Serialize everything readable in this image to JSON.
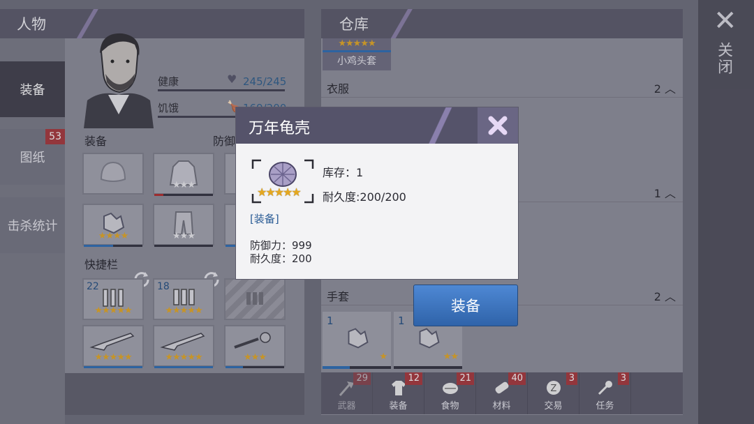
{
  "character": {
    "header": "人物",
    "tabs": [
      {
        "label": "装备",
        "active": true
      },
      {
        "label": "图纸",
        "badge": "53"
      },
      {
        "label": "击杀统计"
      }
    ],
    "stats": [
      {
        "label": "健康",
        "value": "245/245",
        "icon": "heart-icon"
      },
      {
        "label": "饥饿",
        "value": "169/200",
        "icon": "drumstick-icon"
      }
    ],
    "equipment_label": "装备",
    "defense_label": "防御",
    "quickbar_label": "快捷栏",
    "equipment_slots": [
      {
        "icon": "helmet-icon",
        "stars": 0
      },
      {
        "icon": "hoodie-icon",
        "stars": 3,
        "star_color": "gray",
        "durability": 0.15
      },
      {
        "icon": "gloves-icon",
        "stars": 4,
        "durability": 0.5
      },
      {
        "icon": "pants-icon",
        "stars": 3,
        "star_color": "gray"
      }
    ],
    "quick_slots": [
      {
        "icon": "ammo-icon",
        "qty": "22",
        "stars": 5
      },
      {
        "icon": "ammo-icon",
        "qty": "18",
        "stars": 5
      },
      {
        "icon": "ammo-icon",
        "locked": true
      },
      {
        "icon": "shotgun-icon",
        "stars": 5
      },
      {
        "icon": "shotgun-icon",
        "stars": 5
      },
      {
        "icon": "flail-icon",
        "stars": 3
      }
    ]
  },
  "warehouse": {
    "header": "仓库",
    "top_item": {
      "label": "小鸡头套",
      "stars": 5
    },
    "categories": [
      {
        "name": "衣服",
        "count": "2"
      },
      {
        "name": "",
        "count": "1"
      },
      {
        "name": "手套",
        "count": "2"
      }
    ],
    "glove_slots": [
      {
        "qty": "1",
        "stars": 1
      },
      {
        "qty": "1",
        "stars": 2
      }
    ],
    "bottom_tabs": [
      {
        "label": "武器",
        "badge": "29",
        "icon": "axe-icon"
      },
      {
        "label": "装备",
        "badge": "12",
        "icon": "shirt-icon"
      },
      {
        "label": "食物",
        "badge": "21",
        "icon": "meat-icon"
      },
      {
        "label": "材料",
        "badge": "40",
        "icon": "log-icon"
      },
      {
        "label": "交易",
        "badge": "3",
        "icon": "coin-icon"
      },
      {
        "label": "任务",
        "badge": "3",
        "icon": "key-icon"
      }
    ]
  },
  "close": {
    "label": "关闭",
    "icon": "close-icon"
  },
  "popup": {
    "title": "万年龟壳",
    "stock": "库存：1",
    "durability_ratio": "耐久度:200/200",
    "tag": "[装备]",
    "defense": "防御力：999",
    "durability": "耐久度：200",
    "stars": 5,
    "icon": "turtle-shell-icon"
  },
  "equip_button": "装备",
  "colors": {
    "accent": "#3a72c0",
    "star": "#e5a820",
    "badge": "#a7353a",
    "header": "#55536a"
  }
}
